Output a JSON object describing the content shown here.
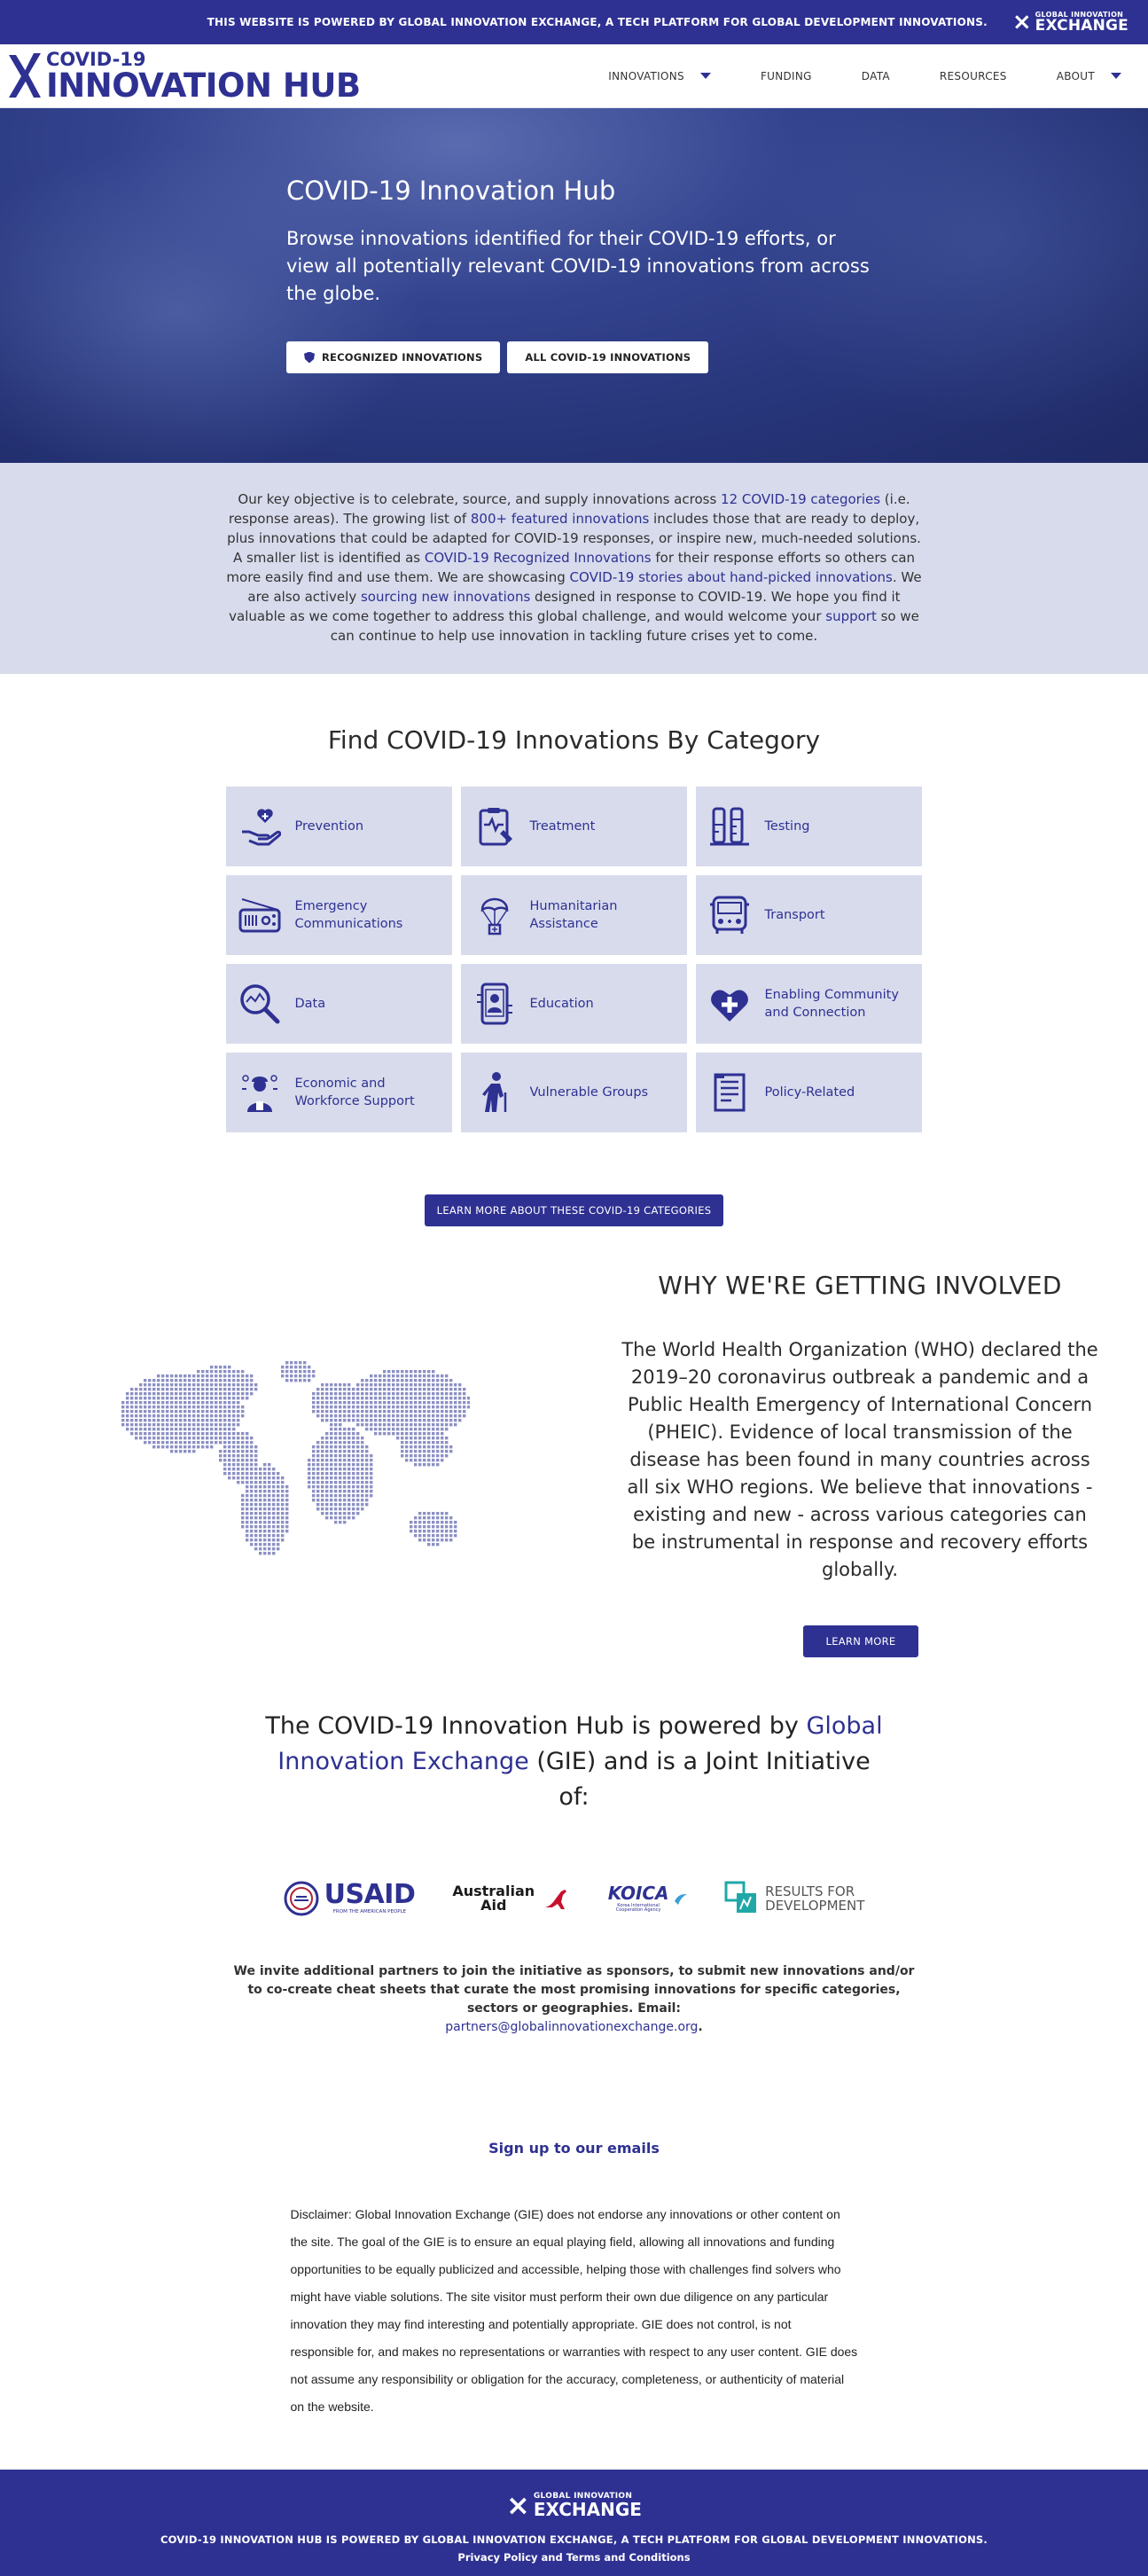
{
  "topbar": {
    "text": "THIS WEBSITE IS POWERED BY GLOBAL INNOVATION EXCHANGE, A TECH PLATFORM FOR GLOBAL DEVELOPMENT INNOVATIONS.",
    "logo_line1": "GLOBAL INNOVATION",
    "logo_line2": "EXCHANGE"
  },
  "header": {
    "brand_line1": "COVID-19",
    "brand_line2": "INNOVATION HUB",
    "nav": [
      "INNOVATIONS",
      "FUNDING",
      "DATA",
      "RESOURCES",
      "ABOUT"
    ]
  },
  "hero": {
    "title": "COVID-19 Innovation Hub",
    "subtitle": "Browse innovations identified for their COVID-19 efforts, or view all potentially relevant COVID-19 innovations from across the globe.",
    "button_recognized": "RECOGNIZED INNOVATIONS",
    "button_all": "ALL COVID-19 INNOVATIONS"
  },
  "intro": {
    "t1": "Our key objective is to celebrate, source, and supply innovations across ",
    "l1": "12 COVID-19 categories",
    "t2": " (i.e. response areas). The growing list of ",
    "l2": "800+ featured innovations",
    "t3": " includes those that are ready to deploy, plus innovations that could be adapted for COVID-19 responses, or inspire new, much-needed solutions. A smaller list is identified as ",
    "l3": "COVID-19 Recognized Innovations",
    "t4": " for their response efforts so others can more easily find and use them. We are showcasing ",
    "l4": "COVID-19 stories about hand-picked innovations",
    "t5": ". We are also actively ",
    "l5": "sourcing new innovations",
    "t6": " designed in response to COVID-19. We hope you find it valuable as we come together to address this global challenge, and would welcome your ",
    "l6": "support",
    "t7": " so we can continue to help use innovation in tackling future crises yet to come."
  },
  "categories": {
    "title": "Find COVID-19 Innovations By Category",
    "items": [
      {
        "label": "Prevention",
        "icon": "hand-heart-icon"
      },
      {
        "label": "Treatment",
        "icon": "clipboard-pulse-icon"
      },
      {
        "label": "Testing",
        "icon": "test-tubes-icon"
      },
      {
        "label": "Emergency Communications",
        "icon": "radio-icon"
      },
      {
        "label": "Humanitarian Assistance",
        "icon": "parachute-icon"
      },
      {
        "label": "Transport",
        "icon": "bus-icon"
      },
      {
        "label": "Data",
        "icon": "magnifier-chart-icon"
      },
      {
        "label": "Education",
        "icon": "tablet-icon"
      },
      {
        "label": "Enabling Community and Connection",
        "icon": "heart-plus-icon"
      },
      {
        "label": "Economic and Workforce Support",
        "icon": "worker-icon"
      },
      {
        "label": "Vulnerable Groups",
        "icon": "elderly-person-icon"
      },
      {
        "label": "Policy-Related",
        "icon": "document-icon"
      }
    ],
    "learn_more": "LEARN MORE ABOUT THESE COVID-19 CATEGORIES"
  },
  "why": {
    "title": "WHY WE'RE GETTING INVOLVED",
    "text": "The World Health Organization (WHO) declared the 2019–20 coronavirus outbreak a pandemic and a Public Health Emergency of International Concern (PHEIC). Evidence of local transmission of the disease has been found in many countries across all six WHO regions. We believe that innovations - existing and new - across various categories can be instrumental in response and recovery efforts globally.",
    "button": "LEARN MORE"
  },
  "powered": {
    "t1": "The COVID-19 Innovation Hub is powered by ",
    "gie": "Global Innovation Exchange",
    "t2": " (GIE) and is a Joint Initiative of:",
    "partners": {
      "usaid": "USAID",
      "usaid_tag": "FROM THE AMERICAN PEOPLE",
      "aus1": "Australian",
      "aus2": "Aid",
      "koica": "KOICA",
      "koica_tag": "Korea International Cooperation Agency",
      "r4d1": "RESULTS FOR",
      "r4d2": "DEVELOPMENT"
    },
    "invite": "We invite additional partners to join the initiative as sponsors, to submit new innovations and/or to co-create cheat sheets that curate the most promising innovations for specific categories, sectors or geographies. Email:",
    "email": "partners@globalinnovationexchange.org",
    "invite_end": "."
  },
  "signup": "Sign up to our emails",
  "disclaimer": "Disclaimer: Global Innovation Exchange (GIE) does not endorse any innovations or other content on the site. The goal of the GIE is to ensure an equal playing field, allowing all innovations and funding opportunities to be equally publicized and accessible, helping those with challenges find solvers who might have viable solutions. The site visitor must perform their own due diligence on any particular innovation they may find interesting and potentially appropriate. GIE does not control, is not responsible for, and makes no representations or warranties with respect to any user content. GIE does not assume any responsibility or obligation for the accuracy, completeness, or authenticity of material on the website.",
  "footer": {
    "logo_line1": "GLOBAL INNOVATION",
    "logo_line2": "EXCHANGE",
    "text": "COVID-19 INNOVATION HUB IS POWERED BY GLOBAL INNOVATION EXCHANGE, A TECH PLATFORM FOR GLOBAL DEVELOPMENT INNOVATIONS.",
    "link": "Privacy Policy and Terms and Conditions"
  },
  "colors": {
    "brand": "#2e3192",
    "light_panel": "#d8dbec",
    "hero": "#27357a"
  }
}
